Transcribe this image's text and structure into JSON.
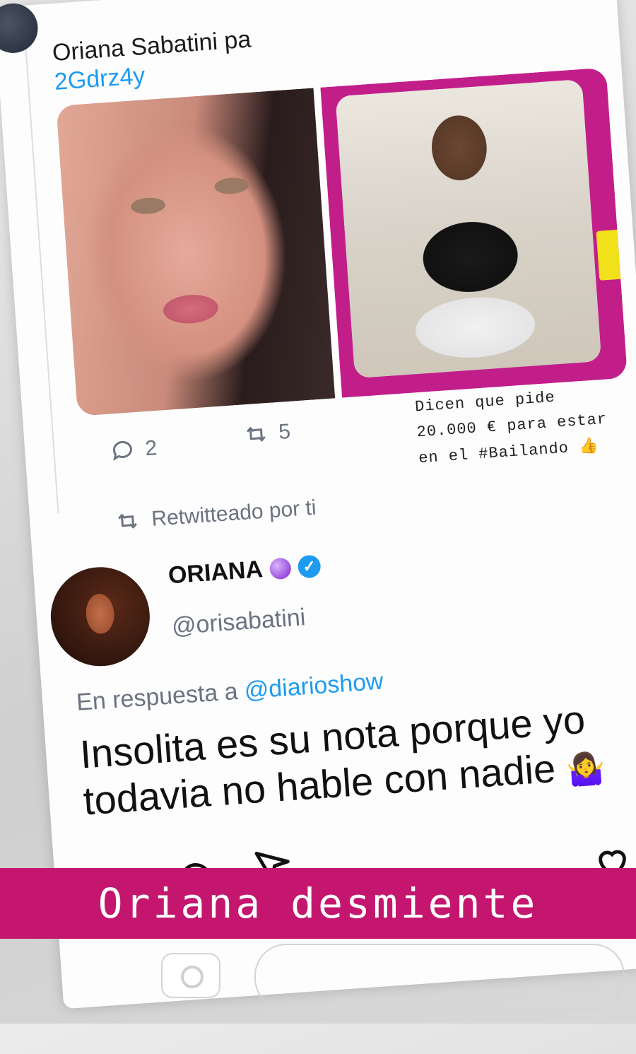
{
  "post": {
    "text_line": "Oriana Sabatini pa",
    "link": "2Gdrz4y",
    "replies_count": "2",
    "retweets_count": "5",
    "caption": {
      "line1": "Dicen que pide",
      "line2": "20.000 € para estar",
      "line3": "en el #Bailando",
      "emoji": "👍"
    }
  },
  "retweeted_label": "Retwitteado por ti",
  "reply_tweet": {
    "name": "ORIANA",
    "handle": "@orisabatini",
    "reply_prefix": "En respuesta a",
    "reply_mention": "@diarioshow",
    "text_line1": "Insolita es su nota porque yo",
    "text_line2": "todavia no hable con nadie",
    "emoji": "🤷‍♀️"
  },
  "banner": {
    "text": "Oriana desmiente"
  },
  "icons": {
    "reply": "reply-icon",
    "retweet": "retweet-icon",
    "like": "heart-icon",
    "comment": "comment-icon",
    "share": "send-icon",
    "camera": "camera-icon"
  },
  "colors": {
    "banner": "#c4166f",
    "accent": "#1d9bf0",
    "magenta_frame": "#c21e8a"
  }
}
